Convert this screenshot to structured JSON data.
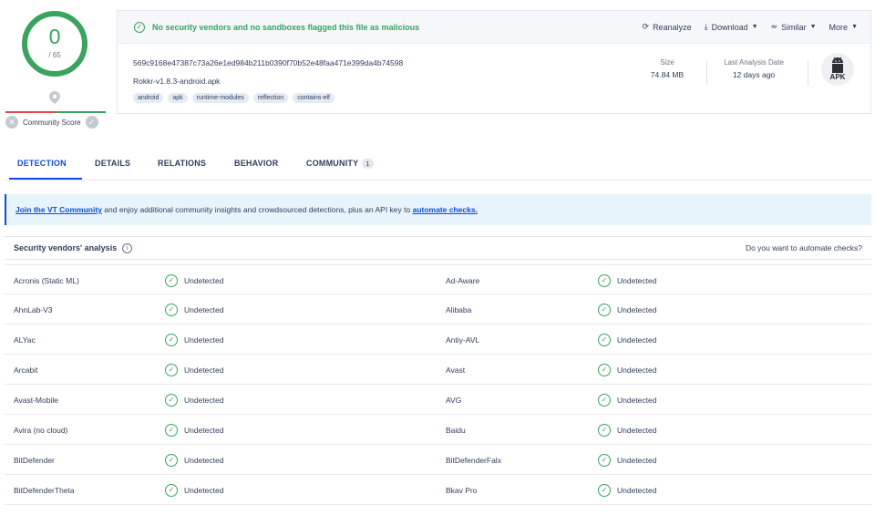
{
  "score": {
    "detections": "0",
    "total": "/ 65",
    "community_label": "Community Score",
    "community_down": "✕",
    "community_up": "✓",
    "ring_color": "#3aa35f"
  },
  "summary": {
    "status_message": "No security vendors and no sandboxes flagged this file as malicious",
    "actions": {
      "reanalyze": "Reanalyze",
      "download": "Download",
      "similar": "Similar",
      "more": "More"
    },
    "hash": "569c9168e47387c73a26e1ed984b211b0390f70b52e48faa471e399da4b74598",
    "filename": "Rokkr-v1.8.3-android.apk",
    "tags": [
      "android",
      "apk",
      "runtime-modules",
      "reflection",
      "contains-elf"
    ],
    "size_label": "Size",
    "size_value": "74.84 MB",
    "last_analysis_label": "Last Analysis Date",
    "last_analysis_value": "12 days ago",
    "file_type_badge": "APK"
  },
  "tabs": [
    {
      "label": "DETECTION",
      "active": true
    },
    {
      "label": "DETAILS"
    },
    {
      "label": "RELATIONS"
    },
    {
      "label": "BEHAVIOR"
    },
    {
      "label": "COMMUNITY",
      "count": "1"
    }
  ],
  "banner": {
    "link1": "Join the VT Community",
    "text": " and enjoy additional community insights and crowdsourced detections, plus an API key to ",
    "link2": "automate checks."
  },
  "vendors": {
    "title": "Security vendors' analysis",
    "automate_prompt": "Do you want to automate checks?",
    "rows": [
      {
        "v1": "Acronis (Static ML)",
        "r1": "Undetected",
        "v2": "Ad-Aware",
        "r2": "Undetected"
      },
      {
        "v1": "AhnLab-V3",
        "r1": "Undetected",
        "v2": "Alibaba",
        "r2": "Undetected"
      },
      {
        "v1": "ALYac",
        "r1": "Undetected",
        "v2": "Antiy-AVL",
        "r2": "Undetected"
      },
      {
        "v1": "Arcabit",
        "r1": "Undetected",
        "v2": "Avast",
        "r2": "Undetected"
      },
      {
        "v1": "Avast-Mobile",
        "r1": "Undetected",
        "v2": "AVG",
        "r2": "Undetected"
      },
      {
        "v1": "Avira (no cloud)",
        "r1": "Undetected",
        "v2": "Baidu",
        "r2": "Undetected"
      },
      {
        "v1": "BitDefender",
        "r1": "Undetected",
        "v2": "BitDefenderFalx",
        "r2": "Undetected"
      },
      {
        "v1": "BitDefenderTheta",
        "r1": "Undetected",
        "v2": "Bkav Pro",
        "r2": "Undetected"
      }
    ]
  },
  "colors": {
    "accent": "#0b4dda",
    "clean": "#3aa35f",
    "malicious": "#e5484d"
  }
}
